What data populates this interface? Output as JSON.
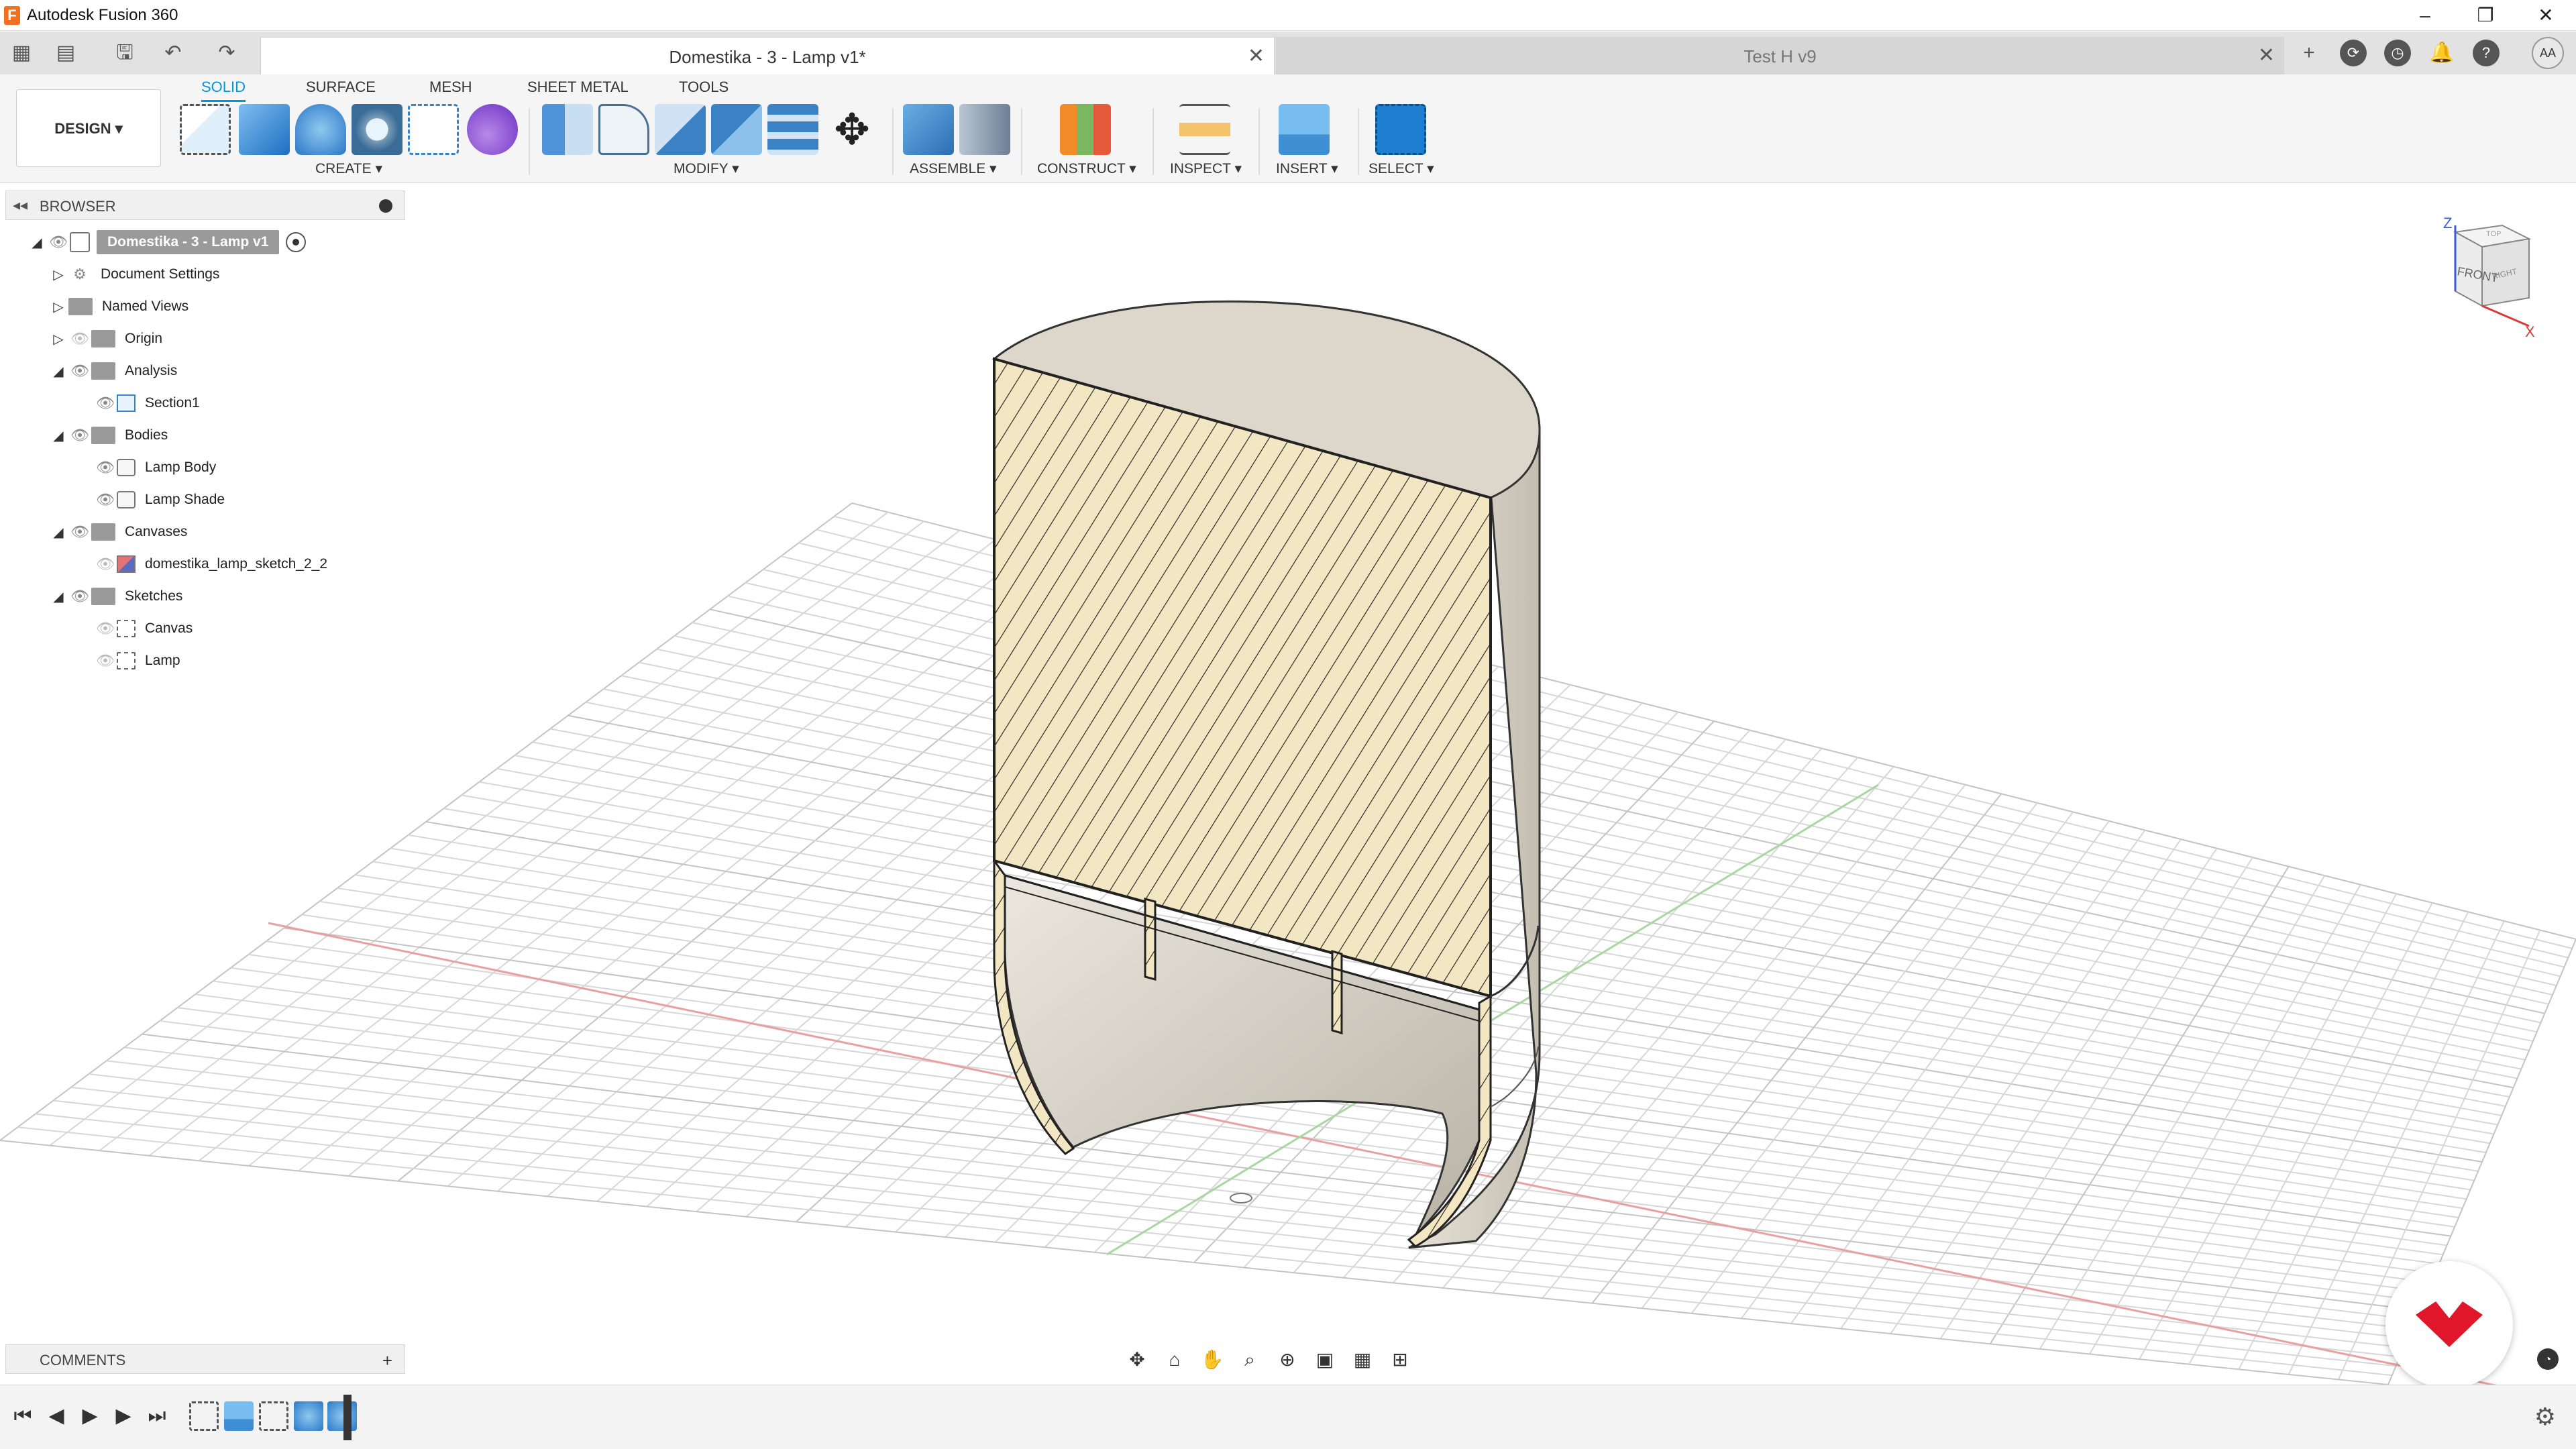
{
  "window": {
    "title": "Autodesk Fusion 360",
    "logo_letter": "F",
    "controls": [
      "–",
      "❐",
      "✕"
    ]
  },
  "tabs": {
    "active": {
      "label": "Domestika - 3 - Lamp v1*"
    },
    "inactive": {
      "label": "Test H v9"
    },
    "close": "✕",
    "new_tab": "+"
  },
  "user": {
    "initials": "AA"
  },
  "ribbon": {
    "tabs": [
      "SOLID",
      "SURFACE",
      "MESH",
      "SHEET METAL",
      "TOOLS"
    ],
    "workspace": "DESIGN ▾",
    "groups": {
      "create": "CREATE ▾",
      "modify": "MODIFY ▾",
      "assemble": "ASSEMBLE ▾",
      "construct": "CONSTRUCT ▾",
      "inspect": "INSPECT ▾",
      "insert": "INSERT ▾",
      "select": "SELECT ▾"
    }
  },
  "browser": {
    "header": "BROWSER",
    "collapse": "◂◂",
    "root": "Domestika - 3 - Lamp v1",
    "items": [
      {
        "label": "Document Settings"
      },
      {
        "label": "Named Views"
      },
      {
        "label": "Origin"
      },
      {
        "label": "Analysis"
      },
      {
        "label": "Section1"
      },
      {
        "label": "Bodies"
      },
      {
        "label": "Lamp Body"
      },
      {
        "label": "Lamp Shade"
      },
      {
        "label": "Canvases"
      },
      {
        "label": "domestika_lamp_sketch_2_2"
      },
      {
        "label": "Sketches"
      },
      {
        "label": "Canvas"
      },
      {
        "label": "Lamp"
      }
    ]
  },
  "viewcube": {
    "face": "FRONT",
    "right": "RIGHT",
    "top": "TOP",
    "z": "Z",
    "x": "X"
  },
  "comments": {
    "label": "COMMENTS",
    "add": "+"
  },
  "colors": {
    "accent": "#0696d7",
    "section_fill": "#f3e6c2",
    "body": "#d9d4c8",
    "grid": "#d7d7d7",
    "brand": "#e0162b"
  }
}
